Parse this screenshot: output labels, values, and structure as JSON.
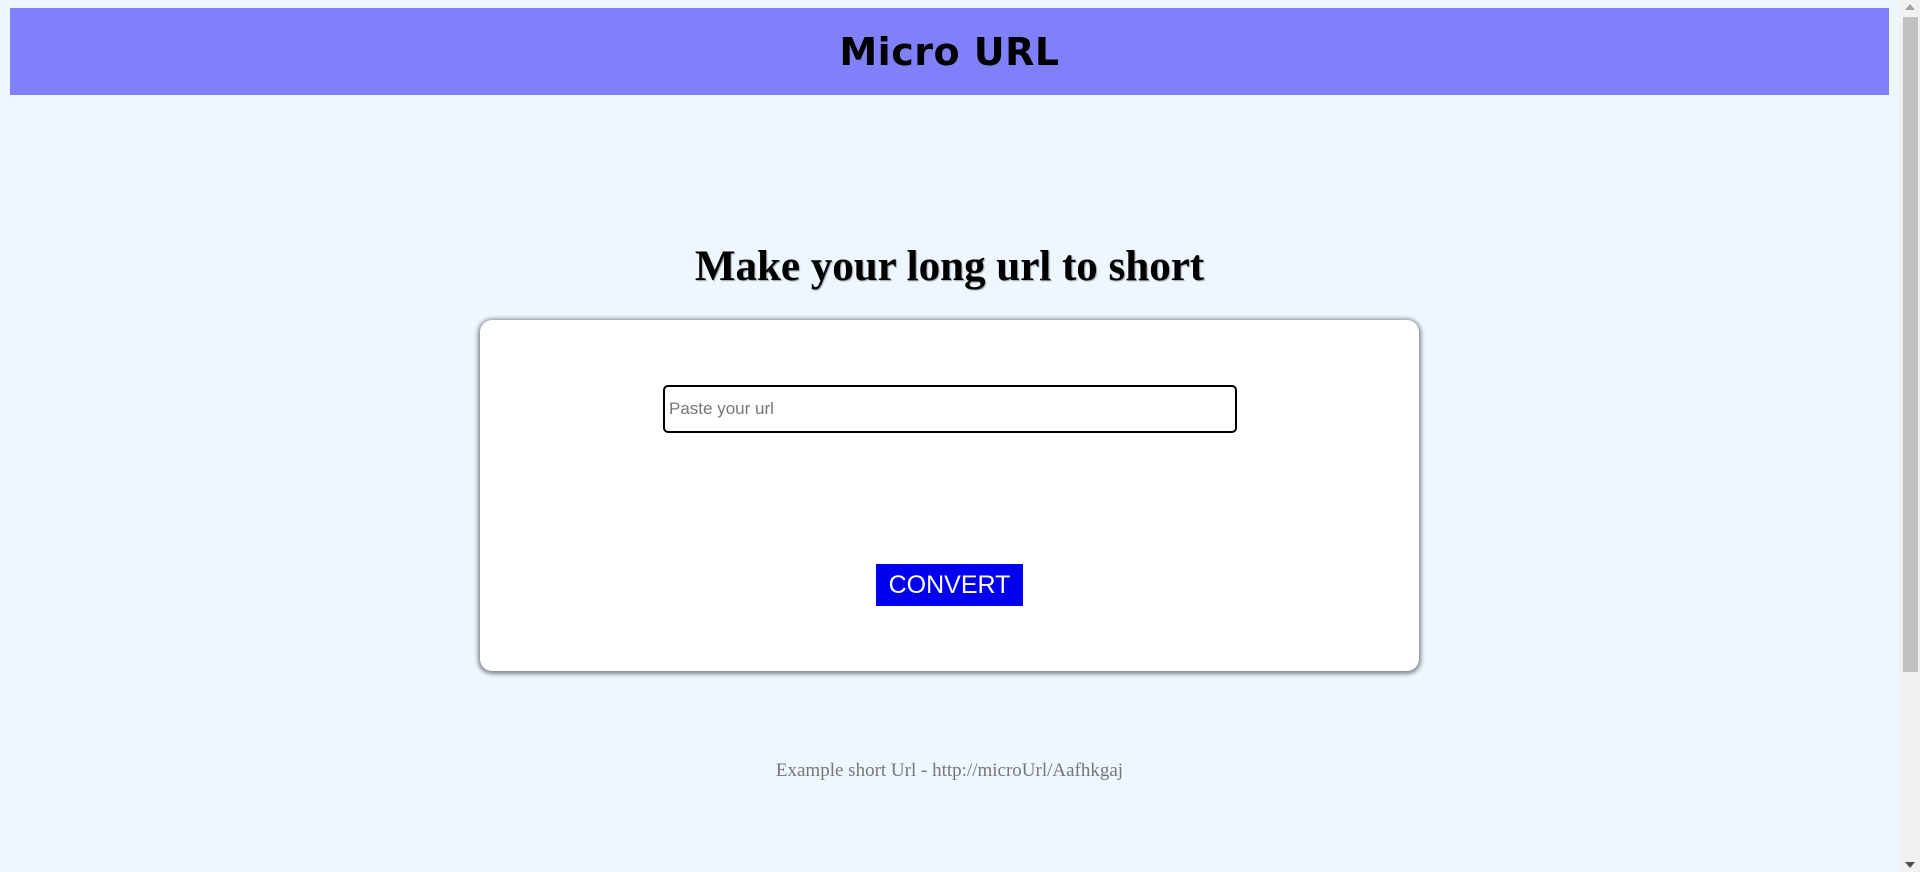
{
  "header": {
    "title": "Micro URL"
  },
  "main": {
    "headline": "Make your long url to short",
    "url_input": {
      "value": "",
      "placeholder": "Paste your url"
    },
    "convert_label": "CONVERT",
    "example_text": "Example short Url - http://microUrl/Aafhkgaj"
  },
  "colors": {
    "header_bg": "#8080fa",
    "page_bg": "#eef6ff",
    "button_bg": "#0000ee",
    "button_text": "#ffffff",
    "example_text": "#777777"
  },
  "icons": {
    "scroll_up": "chevron-up-icon",
    "scroll_down": "chevron-down-icon"
  }
}
